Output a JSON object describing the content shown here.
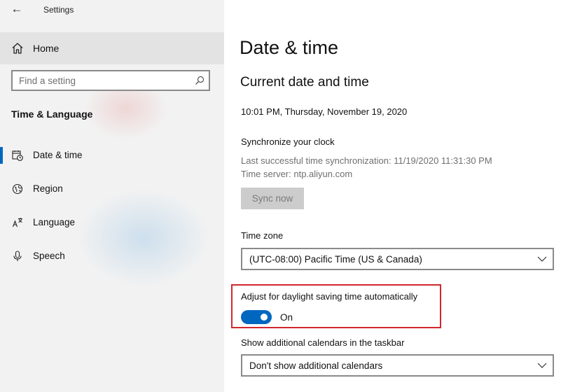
{
  "window": {
    "title": "Settings"
  },
  "sidebar": {
    "home_label": "Home",
    "search_placeholder": "Find a setting",
    "section_heading": "Time & Language",
    "items": [
      {
        "label": "Date & time",
        "icon": "calendar-clock-icon",
        "selected": true
      },
      {
        "label": "Region",
        "icon": "globe-icon",
        "selected": false
      },
      {
        "label": "Language",
        "icon": "language-icon",
        "selected": false
      },
      {
        "label": "Speech",
        "icon": "microphone-icon",
        "selected": false
      }
    ]
  },
  "main": {
    "page_title": "Date & time",
    "section_title": "Current date and time",
    "current_time": "10:01 PM, Thursday, November 19, 2020",
    "sync": {
      "heading": "Synchronize your clock",
      "last_sync": "Last successful time synchronization: 11/19/2020 11:31:30 PM",
      "server": "Time server: ntp.aliyun.com",
      "button_label": "Sync now",
      "button_enabled": false
    },
    "time_zone": {
      "label": "Time zone",
      "value": "(UTC-08:00) Pacific Time (US & Canada)"
    },
    "dst": {
      "label": "Adjust for daylight saving time automatically",
      "state_label": "On",
      "enabled": true
    },
    "calendars": {
      "label": "Show additional calendars in the taskbar",
      "value": "Don't show additional calendars"
    }
  },
  "colors": {
    "accent": "#0067c0",
    "highlight_border": "#d0272d",
    "sidebar_bg": "#f2f2f2",
    "selected_bg": "#e3e3e3"
  }
}
